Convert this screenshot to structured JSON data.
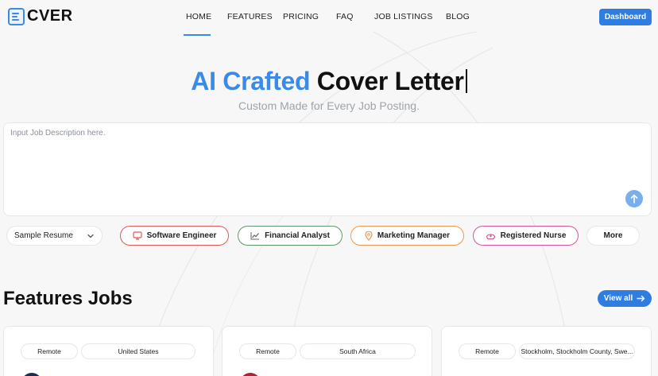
{
  "brand": {
    "name": "CVER"
  },
  "nav": {
    "items": [
      {
        "label": "HOME"
      },
      {
        "label": "FEATURES"
      },
      {
        "label": "PRICING"
      },
      {
        "label": "FAQ"
      },
      {
        "label": "JOB LISTINGS"
      },
      {
        "label": "BLOG"
      }
    ],
    "dashboard_label": "Dashboard"
  },
  "hero": {
    "title_accent": "AI Crafted",
    "title_rest": "Cover Letter",
    "subtitle": "Custom Made for Every Job Posting."
  },
  "job_description": {
    "value": "",
    "placeholder": "Input Job Description here."
  },
  "sample_resume": {
    "selected": "Sample Resume"
  },
  "chips": [
    {
      "label": "Software Engineer",
      "icon": "monitor-icon",
      "color": "#e05a5a"
    },
    {
      "label": "Financial Analyst",
      "icon": "chart-line-icon",
      "color": "#5f9a6a"
    },
    {
      "label": "Marketing Manager",
      "icon": "location-pin-icon",
      "color": "#e89a52"
    },
    {
      "label": "Registered Nurse",
      "icon": "nurse-cap-icon",
      "color": "#d9559a"
    },
    {
      "label": "More",
      "icon": "",
      "color": "#e6e7ea"
    }
  ],
  "features": {
    "title": "Features Jobs",
    "view_all_label": "View all"
  },
  "jobs": [
    {
      "type": "Remote",
      "location": "United States",
      "logo_color": "#1e2a5a"
    },
    {
      "type": "Remote",
      "location": "South Africa",
      "logo_color": "#b3203a"
    },
    {
      "type": "Remote",
      "location": "Stockholm, Stockholm County, Swe...",
      "logo_color": ""
    }
  ],
  "colors": {
    "accent": "#3b8ae6",
    "button": "#2f7de1"
  }
}
